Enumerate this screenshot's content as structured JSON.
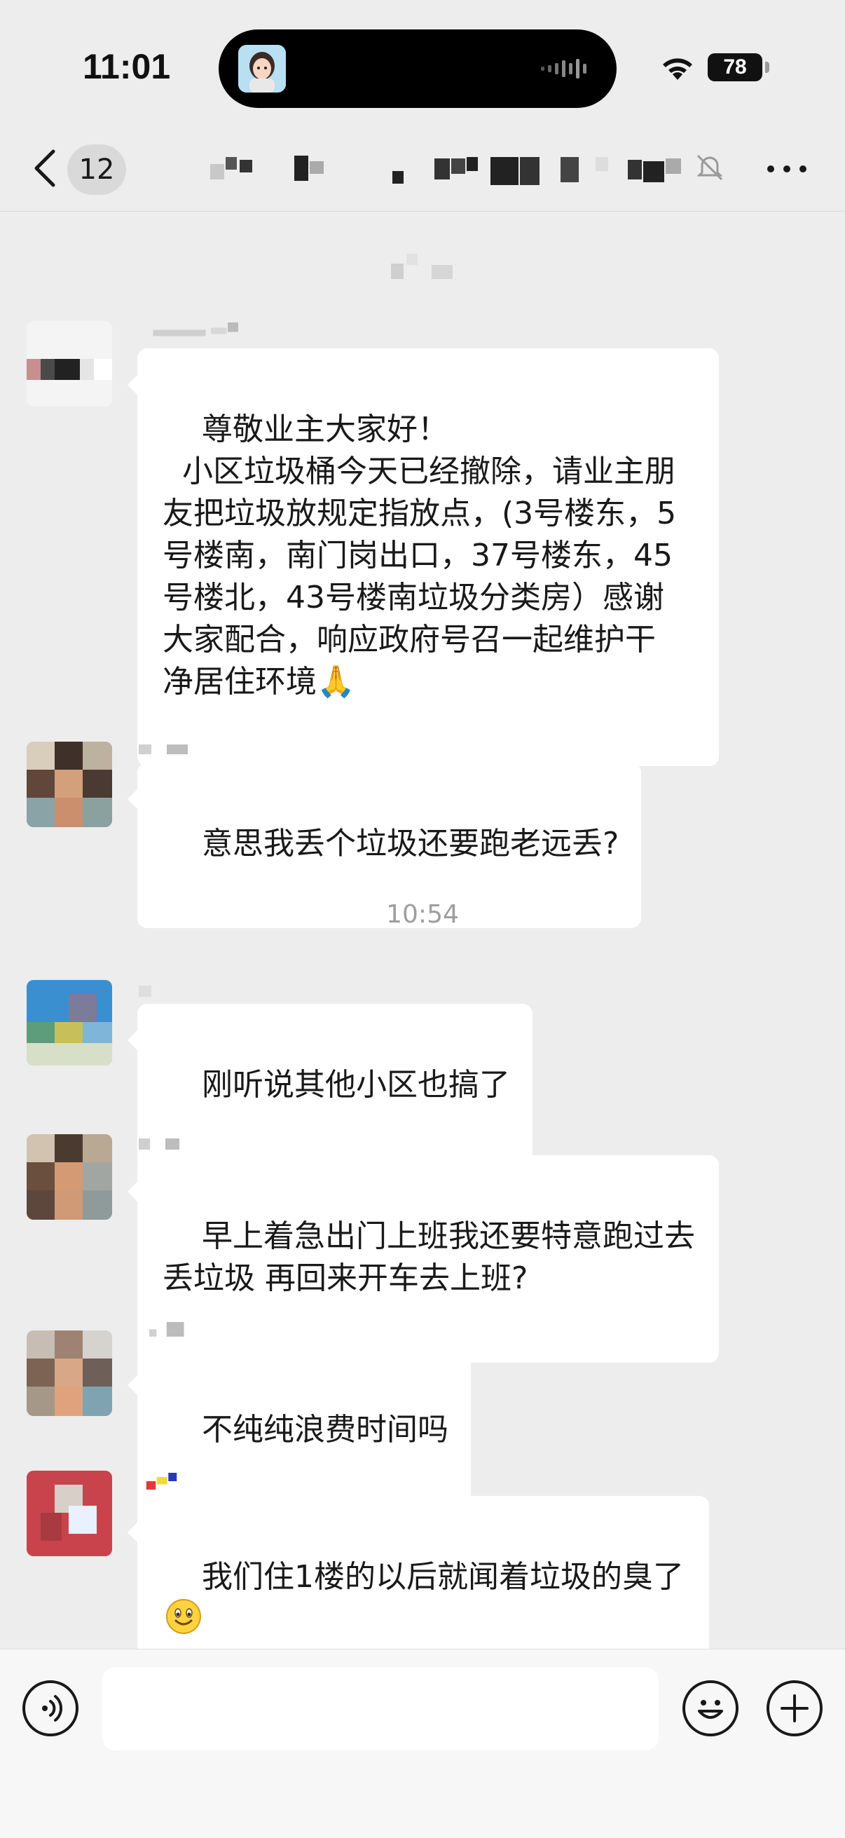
{
  "status_bar": {
    "time": "11:01",
    "battery": "78",
    "icons": [
      "wifi-icon",
      "battery-icon"
    ]
  },
  "header": {
    "unread_count": "12",
    "title_redacted": true,
    "icons": [
      "back-icon",
      "mute-icon",
      "more-icon"
    ]
  },
  "messages": [
    {
      "type": "text",
      "text": "尊敬业主大家好！\n  小区垃圾桶今天已经撤除，请业主朋友把垃圾放规定指放点，(3号楼东，5号楼南，南门岗出口，37号楼东，45号楼北，43号楼南垃圾分类房）感谢大家配合，响应政府号召一起维护干净居住环境",
      "trailing_emoji": "🙏"
    },
    {
      "type": "text",
      "text": "意思我丢个垃圾还要跑老远丢?"
    },
    {
      "type": "time",
      "text": "10:54"
    },
    {
      "type": "text",
      "text": "刚听说其他小区也搞了"
    },
    {
      "type": "text",
      "text": "早上着急出门上班我还要特意跑过去丢垃圾 再回来开车去上班?"
    },
    {
      "type": "text",
      "text": "不纯纯浪费时间吗"
    },
    {
      "type": "text",
      "text": "我们住1楼的以后就闻着垃圾的臭了",
      "trailing_emoji": "smiley-emoji"
    }
  ],
  "input_bar": {
    "value": "",
    "icons": [
      "voice-icon",
      "emoji-icon",
      "plus-icon"
    ]
  },
  "colors": {
    "background": "#ededed",
    "bubble": "#ffffff",
    "timestamp": "#9e9e9e",
    "text": "#191919"
  }
}
